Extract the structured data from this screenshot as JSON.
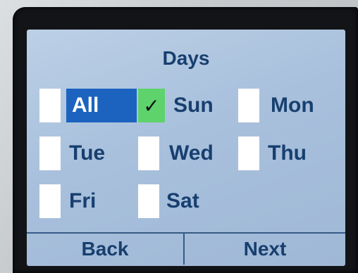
{
  "screen": {
    "title": "Days",
    "options": [
      {
        "label": "All",
        "checked": false,
        "selected": true
      },
      {
        "label": "Sun",
        "checked": true,
        "selected": false
      },
      {
        "label": "Mon",
        "checked": false,
        "selected": false
      },
      {
        "label": "Tue",
        "checked": false,
        "selected": false
      },
      {
        "label": "Wed",
        "checked": false,
        "selected": false
      },
      {
        "label": "Thu",
        "checked": false,
        "selected": false
      },
      {
        "label": "Fri",
        "checked": false,
        "selected": false
      },
      {
        "label": "Sat",
        "checked": false,
        "selected": false
      }
    ],
    "check_glyph": "✓",
    "softkeys": {
      "back": "Back",
      "next": "Next"
    },
    "colors": {
      "selected": "#1b63bf",
      "checked": "#5ed36b"
    }
  }
}
